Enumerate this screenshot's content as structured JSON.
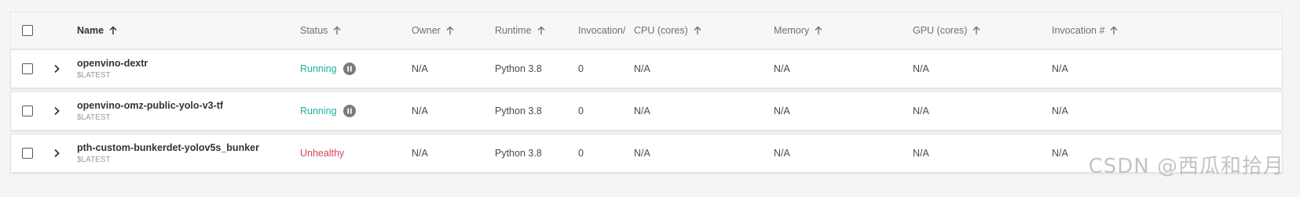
{
  "columns": {
    "name": "Name",
    "status": "Status",
    "owner": "Owner",
    "runtime": "Runtime",
    "invocation_truncated": "Invocation/",
    "cpu": "CPU (cores)",
    "memory": "Memory",
    "gpu": "GPU (cores)",
    "invocation_count": "Invocation #"
  },
  "rows": [
    {
      "name": "openvino-dextr",
      "tag": "$LATEST",
      "status": "Running",
      "status_kind": "running",
      "owner": "N/A",
      "runtime": "Python 3.8",
      "invocation": "0",
      "cpu": "N/A",
      "memory": "N/A",
      "gpu": "N/A",
      "invocation_count": "N/A"
    },
    {
      "name": "openvino-omz-public-yolo-v3-tf",
      "tag": "$LATEST",
      "status": "Running",
      "status_kind": "running",
      "owner": "N/A",
      "runtime": "Python 3.8",
      "invocation": "0",
      "cpu": "N/A",
      "memory": "N/A",
      "gpu": "N/A",
      "invocation_count": "N/A"
    },
    {
      "name": "pth-custom-bunkerdet-yolov5s_bunker",
      "tag": "$LATEST",
      "status": "Unhealthy",
      "status_kind": "unhealthy",
      "owner": "N/A",
      "runtime": "Python 3.8",
      "invocation": "0",
      "cpu": "N/A",
      "memory": "N/A",
      "gpu": "N/A",
      "invocation_count": "N/A"
    }
  ],
  "icons": {
    "sort": "arrow-up-icon",
    "expand": "chevron-right-icon",
    "pause": "pause-circle-icon"
  },
  "colors": {
    "running": "#20b2a0",
    "unhealthy": "#d0455a"
  },
  "watermark": "CSDN @西瓜和拾月"
}
